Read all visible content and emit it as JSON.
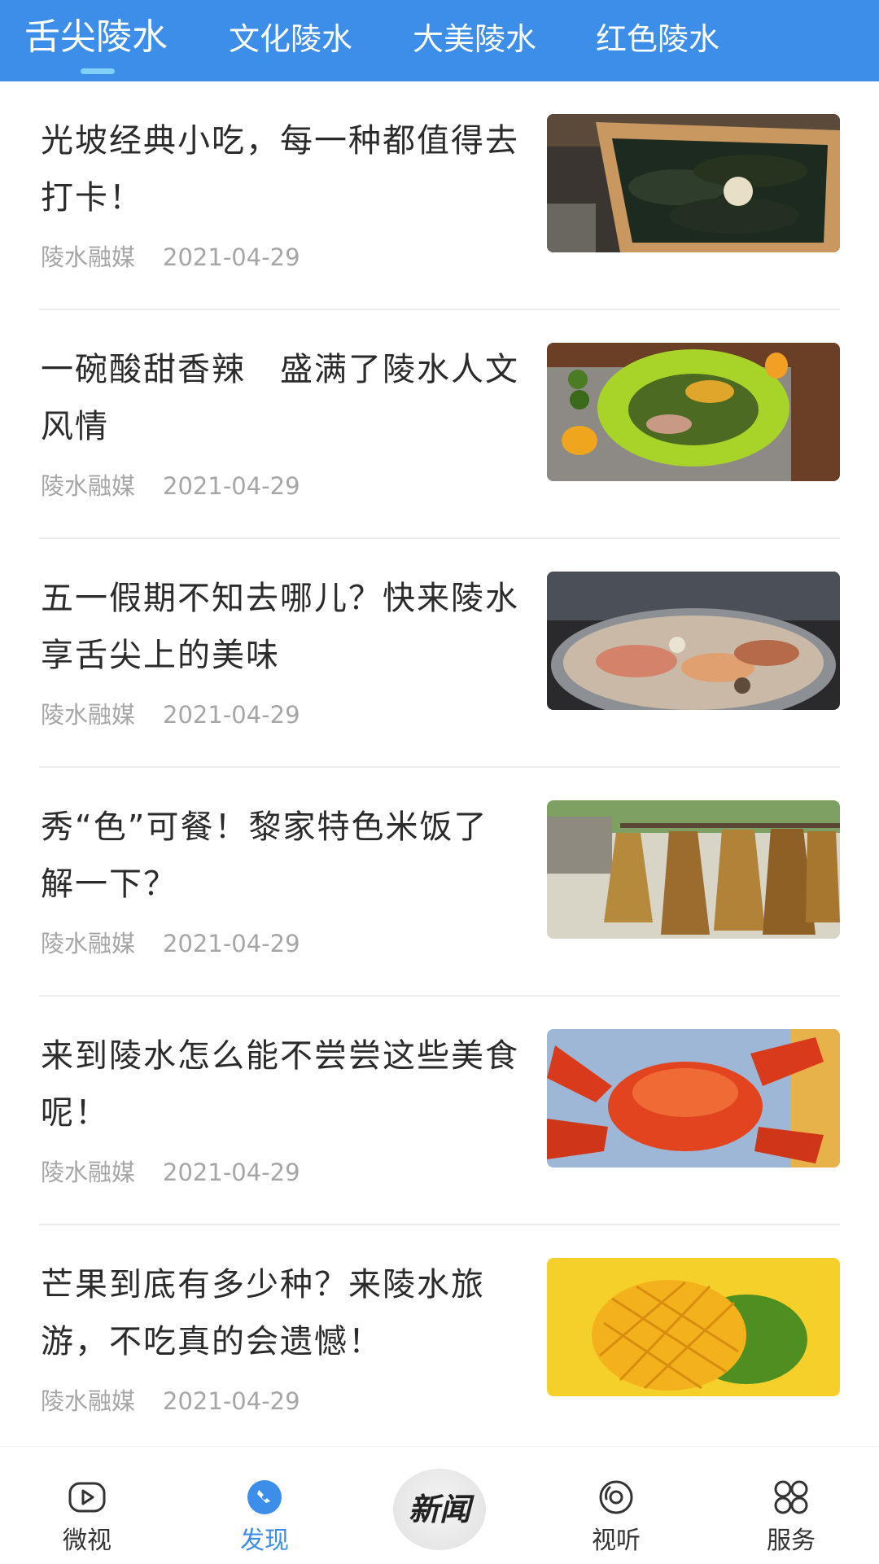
{
  "top_tabs": [
    {
      "label": "舌尖陵水",
      "active": true
    },
    {
      "label": "文化陵水",
      "active": false
    },
    {
      "label": "大美陵水",
      "active": false
    },
    {
      "label": "红色陵水",
      "active": false
    }
  ],
  "colors": {
    "accent": "#3d8ee8",
    "indicator": "#7fd0ff",
    "meta_text": "#a6a6a6"
  },
  "articles": [
    {
      "title": "光坡经典小吃，每一种都值得去打卡！",
      "source": "陵水融媒",
      "date": "2021-04-29",
      "image": "sea-cucumber-dish"
    },
    {
      "title": "一碗酸甜香辣　盛满了陵水人文风情",
      "source": "陵水融媒",
      "date": "2021-04-29",
      "image": "green-plate-salad"
    },
    {
      "title": "五一假期不知去哪儿？快来陵水享舌尖上的美味",
      "source": "陵水融媒",
      "date": "2021-04-29",
      "image": "seafood-hotpot"
    },
    {
      "title": "秀“色”可餐！黎家特色米饭了解一下？",
      "source": "陵水融媒",
      "date": "2021-04-29",
      "image": "hanging-rice-sheaves"
    },
    {
      "title": "来到陵水怎么能不尝尝这些美食呢！",
      "source": "陵水融媒",
      "date": "2021-04-29",
      "image": "red-crab"
    },
    {
      "title": "芒果到底有多少种？来陵水旅游，不吃真的会遗憾！",
      "source": "陵水融媒",
      "date": "2021-04-29",
      "image": "mango"
    }
  ],
  "bottom_nav": {
    "weishi": "微视",
    "faxian": "发现",
    "xinwen": "新闻",
    "shiting": "视听",
    "fuwu": "服务"
  }
}
